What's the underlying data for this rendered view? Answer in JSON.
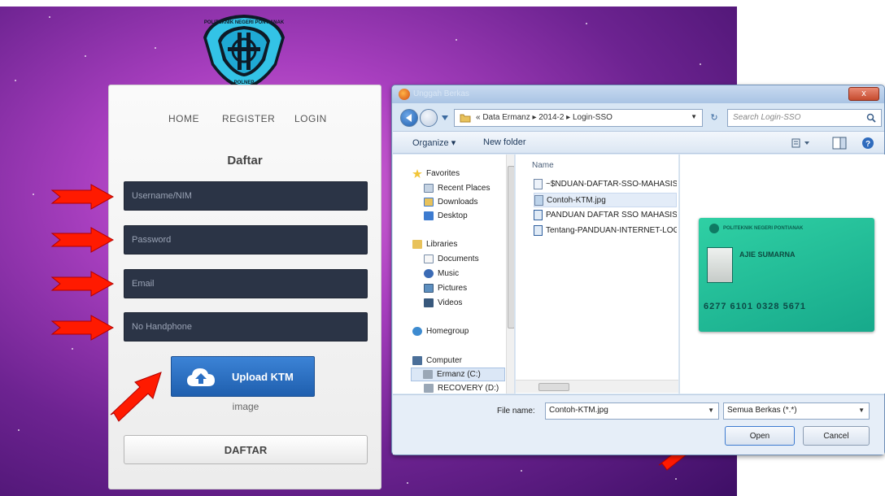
{
  "registration": {
    "nav": {
      "home": "HOME",
      "register": "REGISTER",
      "login": "LOGIN"
    },
    "title": "Daftar",
    "fields": {
      "username_placeholder": "Username/NIM",
      "password_placeholder": "Password",
      "email_placeholder": "Email",
      "phone_placeholder": "No Handphone"
    },
    "upload_button": "Upload KTM",
    "image_label": "image",
    "submit_button": "DAFTAR"
  },
  "logo": {
    "top_text": "POLITEKNIK NEGERI PONTIANAK",
    "bottom_text": "POLNEP"
  },
  "dialog": {
    "title": "Unggah Berkas",
    "close_label": "x",
    "path": "« Data Ermanz  ▸  2014-2  ▸  Login-SSO",
    "search_placeholder": "Search Login-SSO",
    "toolbar": {
      "organize": "Organize ▾",
      "new_folder": "New folder"
    },
    "sidebar": [
      {
        "label": "Favorites",
        "icon": "star-icon"
      },
      {
        "label": "Recent Places",
        "icon": "recent-places-icon"
      },
      {
        "label": "Downloads",
        "icon": "downloads-icon"
      },
      {
        "label": "Desktop",
        "icon": "desktop-icon"
      },
      {
        "label": "Libraries",
        "icon": "libraries-icon"
      },
      {
        "label": "Documents",
        "icon": "documents-icon"
      },
      {
        "label": "Music",
        "icon": "music-icon"
      },
      {
        "label": "Pictures",
        "icon": "pictures-icon"
      },
      {
        "label": "Videos",
        "icon": "videos-icon"
      },
      {
        "label": "Homegroup",
        "icon": "homegroup-icon"
      },
      {
        "label": "Computer",
        "icon": "computer-icon"
      },
      {
        "label": "Ermanz (C:)",
        "icon": "drive-icon"
      },
      {
        "label": "RECOVERY (D:)",
        "icon": "drive-icon"
      }
    ],
    "column_header": "Name",
    "files": [
      {
        "name": "~$NDUAN-DAFTAR-SSO-MAHASIS"
      },
      {
        "name": "Contoh-KTM.jpg"
      },
      {
        "name": "PANDUAN DAFTAR SSO MAHASIS"
      },
      {
        "name": "Tentang-PANDUAN-INTERNET-LOG"
      }
    ],
    "preview": {
      "header": "POLITEKNIK NEGERI PONTIANAK",
      "name": "AJIE SUMARNA",
      "number": "6277 6101 0328 5671"
    },
    "filename_label": "File name:",
    "filename_value": "Contoh-KTM.jpg",
    "filetype_value": "Semua Berkas (*.*)",
    "open_button": "Open",
    "cancel_button": "Cancel"
  },
  "colors": {
    "field_bg": "#2b3446",
    "upload_blue": "#2a6fc4",
    "arrow_red": "#ff1a00",
    "preview_green": "#22bd98"
  }
}
